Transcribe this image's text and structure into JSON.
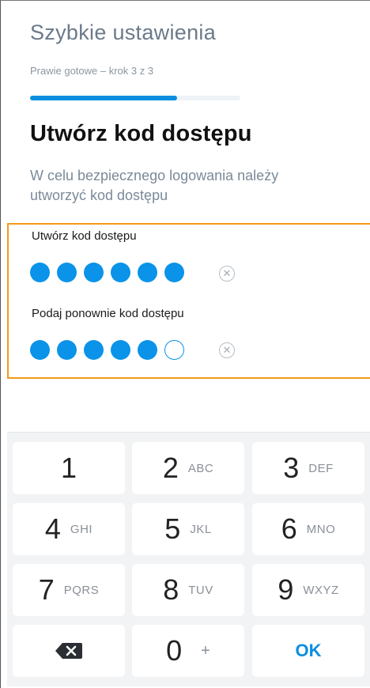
{
  "header": {
    "title": "Szybkie ustawienia"
  },
  "progress": {
    "label": "Prawie gotowe – krok 3 z 3",
    "fraction": 0.7
  },
  "main": {
    "title": "Utwórz kod dostępu",
    "description": "W celu bezpiecznego logowania należy utworzyć kod dostępu"
  },
  "pin": {
    "create_label": "Utwórz kod dostępu",
    "create_filled": 6,
    "create_length": 6,
    "repeat_label": "Podaj ponownie kod dostępu",
    "repeat_filled": 5,
    "repeat_length": 6,
    "clear_icon": "clear-circle-x-icon",
    "clear_glyph": "✕"
  },
  "keypad": {
    "keys": [
      {
        "num": "1",
        "letters": ""
      },
      {
        "num": "2",
        "letters": "ABC"
      },
      {
        "num": "3",
        "letters": "DEF"
      },
      {
        "num": "4",
        "letters": "GHI"
      },
      {
        "num": "5",
        "letters": "JKL"
      },
      {
        "num": "6",
        "letters": "MNO"
      },
      {
        "num": "7",
        "letters": "PQRS"
      },
      {
        "num": "8",
        "letters": "TUV"
      },
      {
        "num": "9",
        "letters": "WXYZ"
      }
    ],
    "zero": {
      "num": "0",
      "extra": "+"
    },
    "ok_label": "OK",
    "backspace_icon": "backspace-icon"
  },
  "colors": {
    "accent": "#0a93e8",
    "highlight": "#f29a1b"
  }
}
